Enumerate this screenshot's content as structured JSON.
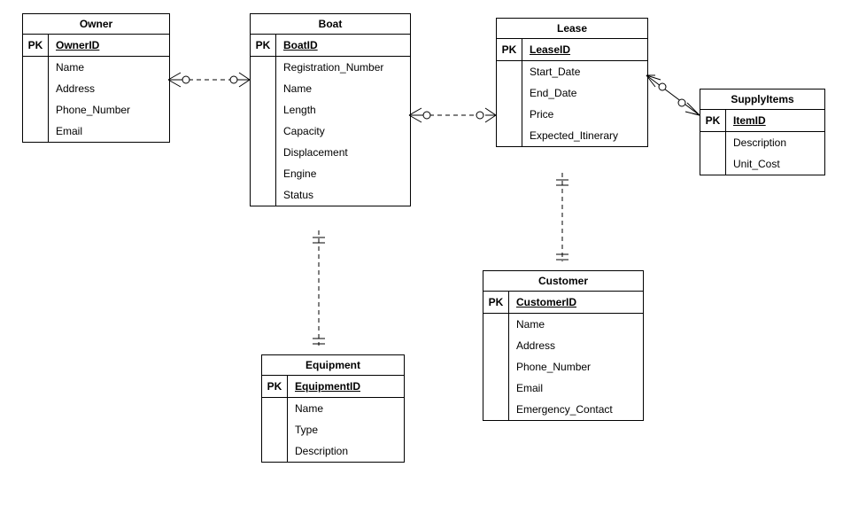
{
  "entities": {
    "owner": {
      "title": "Owner",
      "pk_label": "PK",
      "pk_attr": "OwnerID",
      "attrs": [
        "Name",
        "Address",
        "Phone_Number",
        "Email"
      ]
    },
    "boat": {
      "title": "Boat",
      "pk_label": "PK",
      "pk_attr": "BoatID",
      "attrs": [
        "Registration_Number",
        "Name",
        "Length",
        "Capacity",
        "Displacement",
        "Engine",
        "Status"
      ]
    },
    "lease": {
      "title": "Lease",
      "pk_label": "PK",
      "pk_attr": "LeaseID",
      "attrs": [
        "Start_Date",
        "End_Date",
        "Price",
        "Expected_Itinerary"
      ]
    },
    "supplyitems": {
      "title": "SupplyItems",
      "pk_label": "PK",
      "pk_attr": "ItemID",
      "attrs": [
        "Description",
        "Unit_Cost"
      ]
    },
    "customer": {
      "title": "Customer",
      "pk_label": "PK",
      "pk_attr": "CustomerID",
      "attrs": [
        "Name",
        "Address",
        "Phone_Number",
        "Email",
        "Emergency_Contact"
      ]
    },
    "equipment": {
      "title": "Equipment",
      "pk_label": "PK",
      "pk_attr": "EquipmentID",
      "attrs": [
        "Name",
        "Type",
        "Description"
      ]
    }
  },
  "chart_data": {
    "type": "diagram",
    "diagram_kind": "entity-relationship",
    "entities": [
      {
        "name": "Owner",
        "primary_key": "OwnerID",
        "attributes": [
          "Name",
          "Address",
          "Phone_Number",
          "Email"
        ]
      },
      {
        "name": "Boat",
        "primary_key": "BoatID",
        "attributes": [
          "Registration_Number",
          "Name",
          "Length",
          "Capacity",
          "Displacement",
          "Engine",
          "Status"
        ]
      },
      {
        "name": "Lease",
        "primary_key": "LeaseID",
        "attributes": [
          "Start_Date",
          "End_Date",
          "Price",
          "Expected_Itinerary"
        ]
      },
      {
        "name": "SupplyItems",
        "primary_key": "ItemID",
        "attributes": [
          "Description",
          "Unit_Cost"
        ]
      },
      {
        "name": "Customer",
        "primary_key": "CustomerID",
        "attributes": [
          "Name",
          "Address",
          "Phone_Number",
          "Email",
          "Emergency_Contact"
        ]
      },
      {
        "name": "Equipment",
        "primary_key": "EquipmentID",
        "attributes": [
          "Name",
          "Type",
          "Description"
        ]
      }
    ],
    "relationships": [
      {
        "from": "Owner",
        "to": "Boat",
        "from_end": "zero-or-many",
        "to_end": "zero-or-many",
        "style": "dashed"
      },
      {
        "from": "Boat",
        "to": "Lease",
        "from_end": "zero-or-many",
        "to_end": "zero-or-many",
        "style": "dashed"
      },
      {
        "from": "Lease",
        "to": "SupplyItems",
        "from_end": "zero-or-many",
        "to_end": "zero-or-many",
        "style": "solid"
      },
      {
        "from": "Boat",
        "to": "Equipment",
        "from_end": "one-and-only-one",
        "to_end": "one-and-only-one",
        "style": "dashed"
      },
      {
        "from": "Lease",
        "to": "Customer",
        "from_end": "one-and-only-one",
        "to_end": "one-and-only-one",
        "style": "dashed"
      }
    ]
  }
}
